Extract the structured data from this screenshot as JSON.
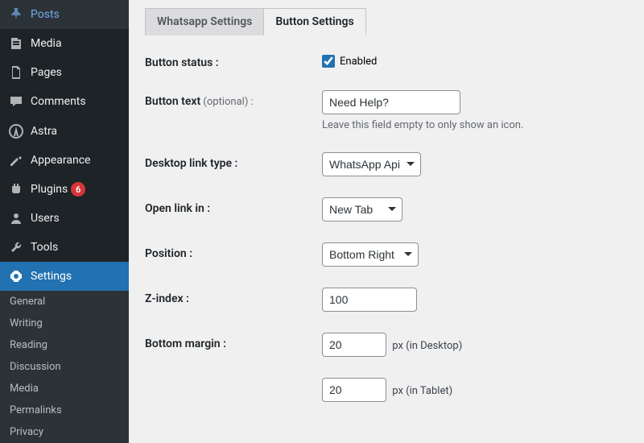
{
  "sidebar": {
    "items": [
      {
        "label": "Posts"
      },
      {
        "label": "Media"
      },
      {
        "label": "Pages"
      },
      {
        "label": "Comments"
      },
      {
        "label": "Astra"
      },
      {
        "label": "Appearance"
      },
      {
        "label": "Plugins",
        "badge": "6"
      },
      {
        "label": "Users"
      },
      {
        "label": "Tools"
      },
      {
        "label": "Settings"
      }
    ],
    "submenu": [
      {
        "label": "General"
      },
      {
        "label": "Writing"
      },
      {
        "label": "Reading"
      },
      {
        "label": "Discussion"
      },
      {
        "label": "Media"
      },
      {
        "label": "Permalinks"
      },
      {
        "label": "Privacy"
      }
    ]
  },
  "tabs": [
    {
      "label": "Whatsapp Settings"
    },
    {
      "label": "Button Settings"
    }
  ],
  "form": {
    "button_status": {
      "label": "Button status :",
      "option": "Enabled"
    },
    "button_text": {
      "label": "Button text",
      "optional": " (optional) :",
      "value": "Need Help?",
      "help": "Leave this field empty to only show an icon."
    },
    "desktop_link_type": {
      "label": "Desktop link type :",
      "value": "WhatsApp Api"
    },
    "open_link_in": {
      "label": "Open link in :",
      "value": "New Tab"
    },
    "position": {
      "label": "Position :",
      "value": "Bottom Right"
    },
    "z_index": {
      "label": "Z-index :",
      "value": "100"
    },
    "bottom_margin": {
      "label": "Bottom margin :",
      "desktop_value": "20",
      "desktop_unit": "px (in Desktop)",
      "tablet_value": "20",
      "tablet_unit": "px (in Tablet)"
    }
  }
}
